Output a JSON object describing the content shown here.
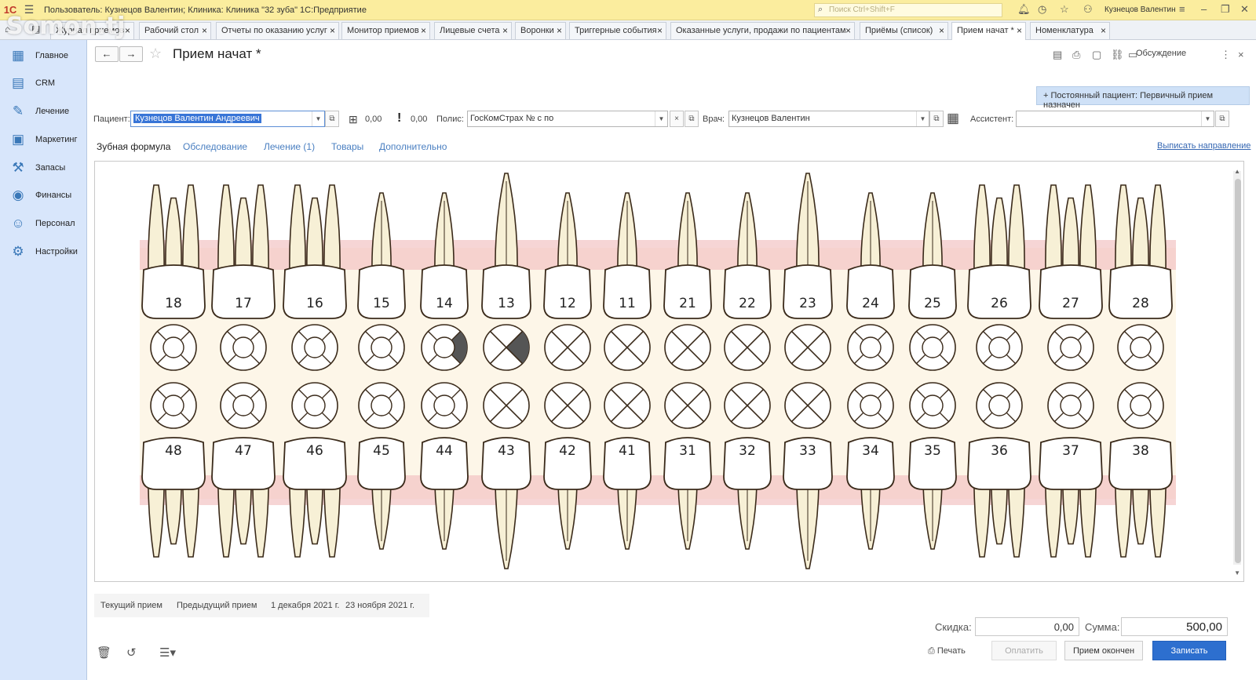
{
  "window": {
    "title": "Пользователь: Кузнецов Валентин;  Клиника: Клиника \"32 зуба\" 1С:Предприятие",
    "search_placeholder": "Поиск Ctrl+Shift+F",
    "user": "Кузнецов Валентин"
  },
  "watermark": "Somon.tj",
  "tabs": [
    {
      "label": "Журнал приемов"
    },
    {
      "label": "Рабочий стол"
    },
    {
      "label": "Отчеты по оказанию услуг"
    },
    {
      "label": "Монитор приемов"
    },
    {
      "label": "Лицевые счета"
    },
    {
      "label": "Воронки"
    },
    {
      "label": "Триггерные события"
    },
    {
      "label": "Оказанные услуги, продажи по пациентам"
    },
    {
      "label": "Приёмы (список)"
    },
    {
      "label": "Прием начат *"
    },
    {
      "label": "Номенклатура"
    }
  ],
  "sidebar": {
    "items": [
      {
        "label": "Главное",
        "icon": "home-icon"
      },
      {
        "label": "CRM",
        "icon": "crm-icon"
      },
      {
        "label": "Лечение",
        "icon": "treatment-icon"
      },
      {
        "label": "Маркетинг",
        "icon": "marketing-icon"
      },
      {
        "label": "Запасы",
        "icon": "stock-icon"
      },
      {
        "label": "Финансы",
        "icon": "finance-icon"
      },
      {
        "label": "Персонал",
        "icon": "staff-icon"
      },
      {
        "label": "Настройки",
        "icon": "settings-icon"
      }
    ]
  },
  "header": {
    "title": "Прием начат *",
    "discuss": "Обсуждение"
  },
  "banner": "+ Постоянный пациент: Первичный прием назначен",
  "form": {
    "patient_label": "Пациент:",
    "patient_value": "Кузнецов Валентин Андреевич",
    "balance1": "0,00",
    "balance2": "0,00",
    "policy_label": "Полис:",
    "policy_value": "ГосКомСтрах № с  по",
    "doctor_label": "Врач:",
    "doctor_value": "Кузнецов Валентин",
    "assistant_label": "Ассистент:",
    "assistant_value": ""
  },
  "form_tabs": [
    {
      "label": "Зубная формула"
    },
    {
      "label": "Обследование"
    },
    {
      "label": "Лечение (1)"
    },
    {
      "label": "Товары"
    },
    {
      "label": "Дополнительно"
    }
  ],
  "referral_link": "Выписать направление",
  "dental_chart": {
    "upper": [
      "18",
      "17",
      "16",
      "15",
      "14",
      "13",
      "12",
      "11",
      "21",
      "22",
      "23",
      "24",
      "25",
      "26",
      "27",
      "28"
    ],
    "lower": [
      "48",
      "47",
      "46",
      "45",
      "44",
      "43",
      "42",
      "41",
      "31",
      "32",
      "33",
      "34",
      "35",
      "36",
      "37",
      "38"
    ],
    "upper_root_type": [
      "molar",
      "molar",
      "molar",
      "single",
      "single",
      "canine",
      "single",
      "single",
      "single",
      "single",
      "canine",
      "single",
      "single",
      "molar",
      "molar",
      "molar"
    ],
    "lower_root_type": [
      "molar",
      "molar",
      "molar",
      "single",
      "single",
      "canine",
      "single",
      "single",
      "single",
      "single",
      "canine",
      "single",
      "single",
      "molar",
      "molar",
      "molar"
    ],
    "upper_marker": [
      "ring",
      "ring",
      "ring",
      "ring",
      "ring-right-dark",
      "x-right-dark",
      "x",
      "x",
      "x",
      "x",
      "x",
      "ring",
      "ring",
      "ring",
      "ring",
      "ring"
    ],
    "lower_marker": [
      "ring",
      "ring",
      "ring",
      "ring",
      "ring",
      "x",
      "x",
      "x",
      "x",
      "x",
      "x",
      "ring",
      "ring",
      "ring",
      "ring",
      "ring"
    ],
    "colors": {
      "gum": "#f2c3c3",
      "background": "#fdf6e8",
      "root": "#f7f0d6",
      "outline": "#3a2a1a",
      "marker_fill": "#555555"
    }
  },
  "visits": {
    "current": "Текущий прием",
    "previous": "Предыдущий прием",
    "date1": "1 декабря 2021 г.",
    "date2": "23 ноября 2021 г."
  },
  "totals": {
    "discount_label": "Скидка:",
    "discount": "0,00",
    "sum_label": "Сумма:",
    "sum": "500,00"
  },
  "buttons": {
    "print": "Печать",
    "pay": "Оплатить",
    "finish": "Прием окончен",
    "save": "Записать"
  }
}
